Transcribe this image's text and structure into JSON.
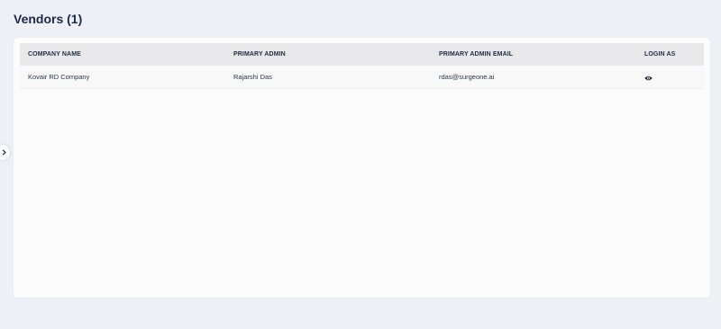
{
  "page": {
    "title": "Vendors (1)"
  },
  "table": {
    "columns": [
      "COMPANY NAME",
      "PRIMARY ADMIN",
      "PRIMARY ADMIN EMAIL",
      "LOGIN AS"
    ],
    "rows": [
      {
        "company_name": "Kovair RD Company",
        "primary_admin": "Rajarshi Das",
        "primary_admin_email": "rdas@surgeone.ai",
        "login_as_icon": "eye-icon"
      }
    ]
  },
  "sidebar_toggle": {
    "icon": "chevron-right-icon"
  },
  "colors": {
    "background": "#eff0f6",
    "card": "#fcfcfd",
    "header_row": "#e9e9eb",
    "title_text": "#1c2948"
  }
}
